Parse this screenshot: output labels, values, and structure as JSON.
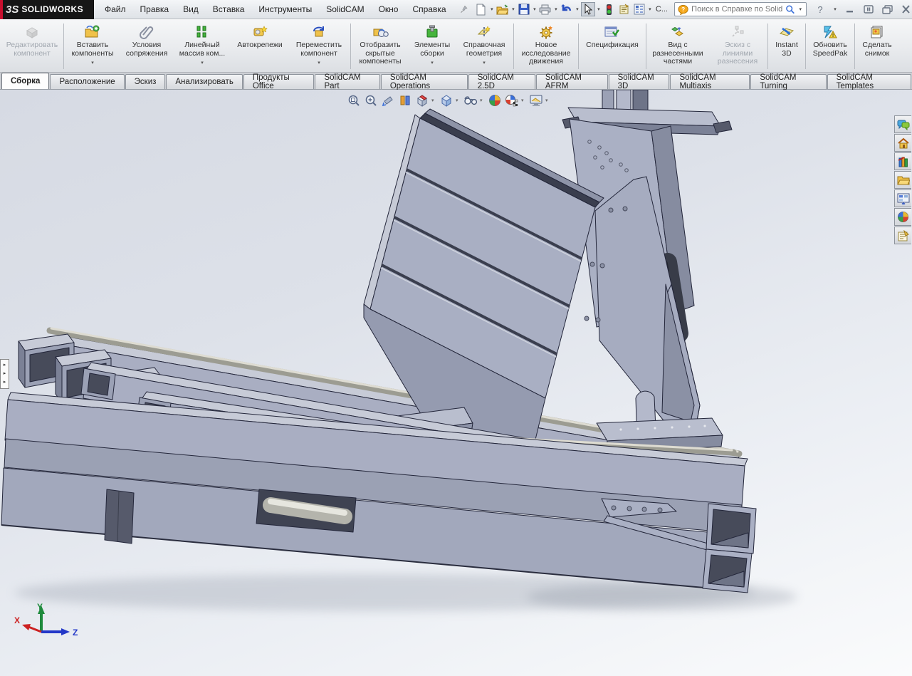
{
  "titlebar": {
    "brand": "SOLIDWORKS",
    "brand_glyph": "3S",
    "menus": [
      "Файл",
      "Правка",
      "Вид",
      "Вставка",
      "Инструменты",
      "SolidCAM",
      "Окно",
      "Справка"
    ],
    "collapsed_toolbar_label": "C...",
    "search": {
      "placeholder": "Поиск в Справке по SolidV"
    },
    "quick_icons": [
      "new-document-icon",
      "open-icon",
      "save-icon",
      "print-icon",
      "undo-icon",
      "select-cursor-icon",
      "rebuild-traffic-light-icon",
      "file-properties-icon",
      "options-list-icon"
    ],
    "window_icons": [
      "help-icon",
      "minimize-icon",
      "restore-icon",
      "cascade-windows-icon",
      "close-icon"
    ]
  },
  "command_manager": {
    "buttons": [
      {
        "label": "Редактировать компонент",
        "icon": "edit-component-icon",
        "enabled": false,
        "dropdown": false
      },
      {
        "label": "Вставить компоненты",
        "icon": "insert-components-icon",
        "enabled": true,
        "dropdown": true
      },
      {
        "label": "Условия сопряжения",
        "icon": "mates-paperclip-icon",
        "enabled": true,
        "dropdown": false
      },
      {
        "label": "Линейный массив ком...",
        "icon": "linear-pattern-icon",
        "enabled": true,
        "dropdown": true
      },
      {
        "label": "Автокрепежи",
        "icon": "smart-fasteners-icon",
        "enabled": true,
        "dropdown": false
      },
      {
        "label": "Переместить компонент",
        "icon": "move-component-icon",
        "enabled": true,
        "dropdown": true
      },
      {
        "label": "Отобразить скрытые компоненты",
        "icon": "show-hidden-components-icon",
        "enabled": true,
        "dropdown": false
      },
      {
        "label": "Элементы сборки",
        "icon": "assembly-features-icon",
        "enabled": true,
        "dropdown": true
      },
      {
        "label": "Справочная геометрия",
        "icon": "reference-geometry-icon",
        "enabled": true,
        "dropdown": true
      },
      {
        "label": "Новое исследование движения",
        "icon": "motion-study-icon",
        "enabled": true,
        "dropdown": false
      },
      {
        "label": "Спецификация",
        "icon": "bom-icon",
        "enabled": true,
        "dropdown": false
      },
      {
        "label": "Вид с разнесенными частями",
        "icon": "exploded-view-icon",
        "enabled": true,
        "dropdown": false
      },
      {
        "label": "Эскиз с линиями разнесения",
        "icon": "explode-line-sketch-icon",
        "enabled": false,
        "dropdown": false
      },
      {
        "label": "Instant 3D",
        "icon": "instant3d-icon",
        "enabled": true,
        "dropdown": false
      },
      {
        "label": "Обновить SpeedPak",
        "icon": "update-speedpak-icon",
        "enabled": true,
        "dropdown": false
      },
      {
        "label": "Сделать снимок",
        "icon": "take-snapshot-icon",
        "enabled": true,
        "dropdown": false
      }
    ]
  },
  "tabs": {
    "items": [
      {
        "label": "Сборка",
        "active": true
      },
      {
        "label": "Расположение",
        "active": false
      },
      {
        "label": "Эскиз",
        "active": false
      },
      {
        "label": "Анализировать",
        "active": false
      },
      {
        "label": "Продукты Office",
        "active": false
      },
      {
        "label": "SolidCAM Part",
        "active": false
      },
      {
        "label": "SolidCAM Operations",
        "active": false
      },
      {
        "label": "SolidCAM 2.5D",
        "active": false
      },
      {
        "label": "SolidCAM AFRM",
        "active": false
      },
      {
        "label": "SolidCAM 3D",
        "active": false
      },
      {
        "label": "SolidCAM Multiaxis",
        "active": false
      },
      {
        "label": "SolidCAM Turning",
        "active": false
      },
      {
        "label": "SolidCAM Templates",
        "active": false
      }
    ]
  },
  "viewport": {
    "headsup_icons": [
      "zoom-to-fit-icon",
      "zoom-to-area-icon",
      "previous-view-icon",
      "section-view-icon",
      "view-orientation-icon",
      "display-style-icon",
      "hide-show-items-icon",
      "apply-scene-icon",
      "view-settings-icon",
      "camera-view-icon"
    ],
    "task_pane_icons": [
      "forum-icon",
      "resources-home-icon",
      "design-library-icon",
      "file-explorer-icon",
      "view-palette-icon",
      "appearances-icon",
      "custom-properties-icon"
    ],
    "flyout_arrows": "▸",
    "triad": {
      "x": "X",
      "y": "Y",
      "z": "Z",
      "x_color": "#cc2222",
      "y_color": "#1e8a3c",
      "z_color": "#2338c8"
    }
  },
  "model": {
    "colors": {
      "face_top": "#c7cbd7",
      "face_front": "#a9aec2",
      "face_mid": "#9ba1b5",
      "face_dark": "#6e7488",
      "inner_shadow": "#474b5a",
      "edge": "#23263a",
      "rail": "#9c9c92",
      "rail_highlight": "#dedcd2",
      "motor_dark": "#383c48",
      "background_top": "#d6dae3",
      "background_bottom": "#fafbfc"
    }
  }
}
